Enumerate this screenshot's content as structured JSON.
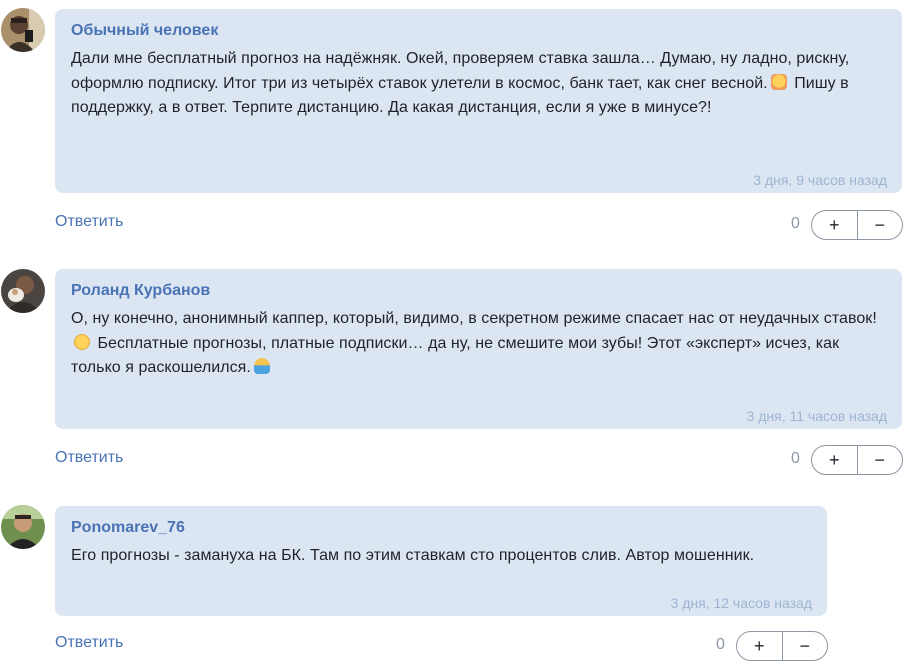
{
  "comments": [
    {
      "author": "Обычный человек",
      "text_parts": [
        "Дали мне бесплатный прогноз на надёжняк. Окей, проверяем ставка зашла… Думаю, ну ладно, рискну, оформлю подписку. Итог три из четырёх ставок улетели в космос, банк тает, как снег весной.",
        "Пишу в поддержку, а в ответ. Терпите дистанцию. Да какая дистанция, если я уже в минусе?!"
      ],
      "emoji_icons": [
        "face-exhaling-emoji"
      ],
      "time": "3 дня, 9 часов назад",
      "reply": "Ответить",
      "score": "0",
      "plus": "+",
      "minus": "−"
    },
    {
      "author": "Роланд Курбанов",
      "text_parts": [
        "О, ну конечно, анонимный каппер, который, видимо, в секретном режиме спасает нас от неудачных ставок!",
        "Бесплатные прогнозы, платные подписки… да ну, не смешите мои зубы! Этот «эксперт» исчез, как только я раскошелился."
      ],
      "emoji_icons": [
        "eye-roll-emoji",
        "shrug-emoji"
      ],
      "time": "3 дня, 11 часов назад",
      "reply": "Ответить",
      "score": "0",
      "plus": "+",
      "minus": "−"
    },
    {
      "author": "Ponomarev_76",
      "text_parts": [
        "Его прогнозы - замануха на БК. Там по этим ставкам сто процентов слив. Автор мошенник."
      ],
      "emoji_icons": [],
      "time": "3 дня, 12 часов назад",
      "reply": "Ответить",
      "score": "0",
      "plus": "+",
      "minus": "−"
    }
  ],
  "colors": {
    "bubble": "#dce6f3",
    "author": "#4a73b6",
    "time": "#9fb4d2",
    "link": "#4a73b6",
    "border": "#8d97a3"
  }
}
